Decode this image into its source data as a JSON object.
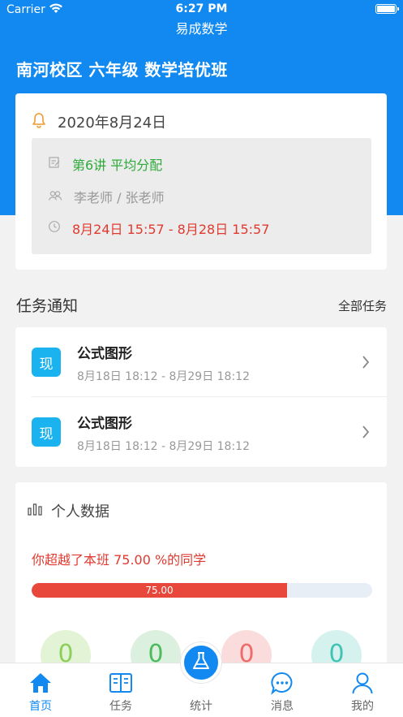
{
  "status_bar": {
    "carrier": "Carrier",
    "time": "6:27 PM"
  },
  "app_title": "易成数学",
  "class_title": "南河校区 六年级 数学培优班",
  "lesson": {
    "date": "2020年8月24日",
    "name": "第6讲 平均分配",
    "teachers": "李老师 / 张老师",
    "period": "8月24日 15:57 - 8月28日 15:57"
  },
  "tasks_section": {
    "title": "任务通知",
    "more_label": "全部任务"
  },
  "tasks": [
    {
      "badge": "现",
      "name": "公式图形",
      "time": "8月18日 18:12 - 8月29日 18:12"
    },
    {
      "badge": "现",
      "name": "公式图形",
      "time": "8月18日 18:12 - 8月29日 18:12"
    }
  ],
  "stats": {
    "title": "个人数据",
    "beat_text": "你超越了本班 75.00 %的同学",
    "progress_value": 75.0,
    "progress_label": "75.00",
    "circles": [
      "0",
      "0",
      "0",
      "0"
    ]
  },
  "tab_bar": {
    "items": [
      {
        "label": "首页",
        "icon": "home-icon",
        "active": true
      },
      {
        "label": "任务",
        "icon": "book-icon",
        "active": false
      },
      {
        "label": "统计",
        "icon": "flask-icon",
        "active": false
      },
      {
        "label": "消息",
        "icon": "chat-icon",
        "active": false
      },
      {
        "label": "我的",
        "icon": "user-icon",
        "active": false
      }
    ]
  },
  "colors": {
    "primary": "#1189f0",
    "accent_red": "#e03a30",
    "accent_green": "#2eaa3a"
  }
}
